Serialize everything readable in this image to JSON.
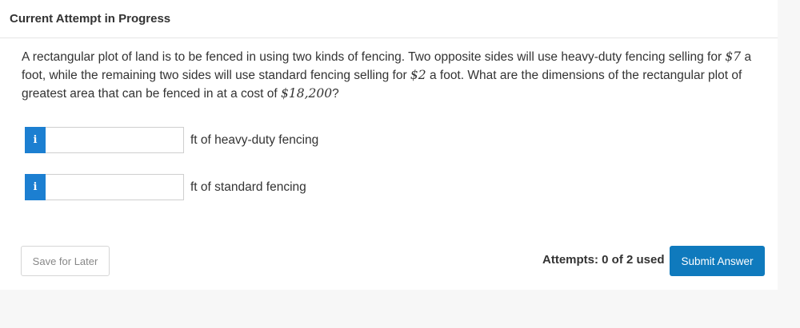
{
  "header": {
    "title": "Current Attempt in Progress"
  },
  "question": {
    "part1": "A rectangular plot of land is to be fenced in using two kinds of fencing. Two opposite sides will use heavy-duty fencing selling for ",
    "price_heavy": "$7",
    "part2": " a foot, while the remaining two sides will use standard fencing selling for ",
    "price_standard": "$2",
    "part3": " a foot. What are the dimensions of the rectangular plot of greatest area that can be fenced in at a cost of ",
    "total_cost": "$18,200",
    "part4": "?"
  },
  "answers": [
    {
      "info_glyph": "i",
      "value": "",
      "unit_label": "ft of heavy-duty fencing"
    },
    {
      "info_glyph": "i",
      "value": "",
      "unit_label": "ft of standard fencing"
    }
  ],
  "footer": {
    "save_label": "Save for Later",
    "attempts_text": "Attempts: 0 of 2 used",
    "submit_label": "Submit Answer"
  },
  "colors": {
    "accent": "#0f7abd",
    "info_badge": "#1c7fd1",
    "background": "#f7f7f7"
  }
}
